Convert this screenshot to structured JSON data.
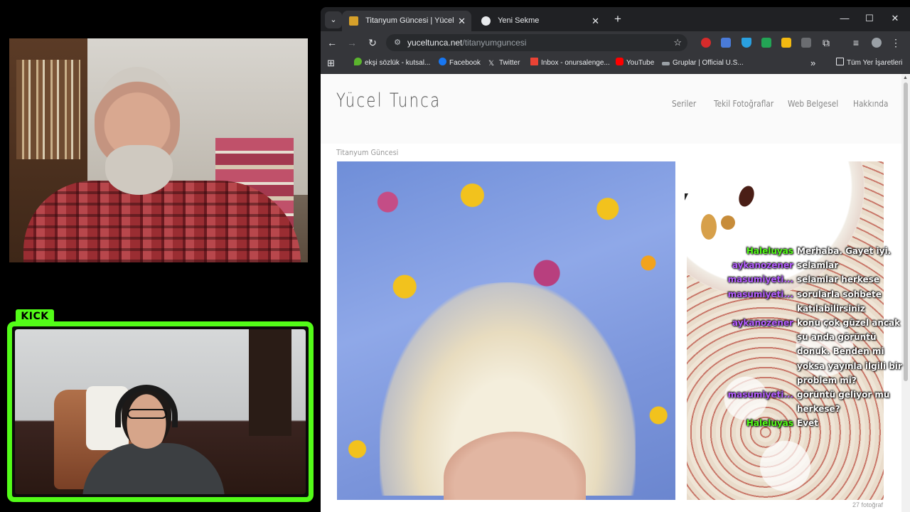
{
  "colors": {
    "kick_green": "#53fc18",
    "chrome_dark": "#202124",
    "chrome_bar": "#35363a",
    "chat_green": "#53fc18",
    "chat_purple": "#b45cff"
  },
  "overlay": {
    "kick_label": "KICK"
  },
  "browser": {
    "tabs": [
      {
        "title": "Titanyum Güncesi | Yücel Tunca",
        "icon": "site-favicon",
        "active": true,
        "close": "✕"
      },
      {
        "title": "Yeni Sekme",
        "icon": "chrome-icon",
        "active": false,
        "close": "✕"
      }
    ],
    "new_tab": "+",
    "window_controls": {
      "minimize": "—",
      "maximize": "☐",
      "close": "✕"
    },
    "tab_list": "⌄",
    "nav": {
      "back": "←",
      "forward": "→",
      "reload": "↻"
    },
    "url": {
      "domain": "yuceltunca.net",
      "path": "/titanyumguncesi",
      "site_icon": "⚙",
      "star": "☆"
    },
    "toolbar_icons": {
      "menu": "⋮",
      "extensions": "⧉",
      "media": "≡"
    },
    "bookmarks": [
      {
        "label": "ekşi sözlük - kutsal...",
        "icon": "eksi-drop-icon",
        "color": "#5bb52d"
      },
      {
        "label": "Facebook",
        "icon": "facebook-icon",
        "color": "#1877f2"
      },
      {
        "label": "Twitter",
        "icon": "x-icon",
        "color": "#e8eaed"
      },
      {
        "label": "Inbox - onursalenge...",
        "icon": "gmail-icon",
        "color": "#ea4335"
      },
      {
        "label": "YouTube",
        "icon": "youtube-icon",
        "color": "#ff0000"
      },
      {
        "label": "Gruplar | Official U.S...",
        "icon": "link-icon",
        "color": "#9aa0a6"
      }
    ],
    "bookmarks_overflow": "»",
    "all_bookmarks": "Tüm Yer İşaretleri"
  },
  "site": {
    "logo": "Yücel Tunca",
    "nav": [
      "Seriler",
      "Tekil Fotoğraflar",
      "Web Belgesel",
      "Hakkında"
    ],
    "breadcrumb": "Titanyum Güncesi",
    "photo_count": "27 fotoğraf",
    "next_arrow": "›"
  },
  "chat": [
    {
      "user": "Haleluyas",
      "color": "#53fc18",
      "message": "Merhaba. Gayet iyi."
    },
    {
      "user": "aykanozener",
      "color": "#b45cff",
      "message": "selamlar"
    },
    {
      "user": "masumiyeti...",
      "color": "#b45cff",
      "message": "selamlar herkese"
    },
    {
      "user": "masumiyeti...",
      "color": "#b45cff",
      "message": "sorularla sohbete katılabilirsiniz"
    },
    {
      "user": "aykanozener",
      "color": "#b45cff",
      "message": "konu çok güzel ancak şu anda görüntü donuk. Benden mi yoksa yayınla ilgili bir problem mi?"
    },
    {
      "user": "masumiyeti...",
      "color": "#b45cff",
      "message": "görüntü geliyor mu herkese?"
    },
    {
      "user": "Haleluyas",
      "color": "#53fc18",
      "message": "Evet"
    }
  ]
}
